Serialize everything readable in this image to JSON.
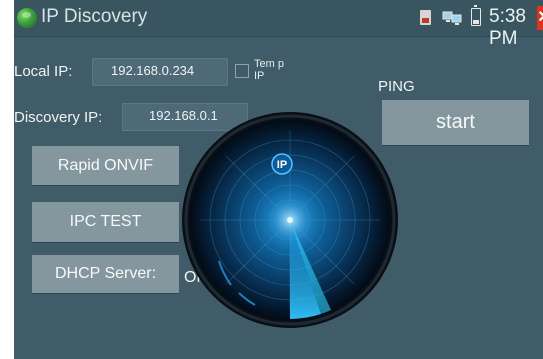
{
  "titlebar": {
    "app_icon": "globe-icon",
    "title": "IP Discovery",
    "status_icons": [
      "sd-card-icon",
      "network-computers-icon",
      "battery-icon"
    ],
    "time": "5:38 PM",
    "close_icon": "close-icon"
  },
  "form": {
    "local_ip_label": "Local IP:",
    "local_ip_value": "192.168.0.234",
    "temp_ip_label": "Tem p IP",
    "temp_ip_checked": false,
    "discovery_ip_label": "Discovery IP:",
    "discovery_ip_value": "192.168.0.1"
  },
  "buttons": {
    "rapid_onvif": "Rapid ONVIF",
    "ipc_test": "IPC TEST",
    "dhcp_server": "DHCP Server:",
    "dhcp_status": "ON"
  },
  "ping": {
    "label": "PING",
    "start_button": "start"
  },
  "radar": {
    "badge_text": "IP"
  },
  "colors": {
    "background": "#3f5c68",
    "titlebar": "#395560",
    "button": "#84979f",
    "radar_glow": "#1ea8f0",
    "close_red": "#e0301e"
  }
}
